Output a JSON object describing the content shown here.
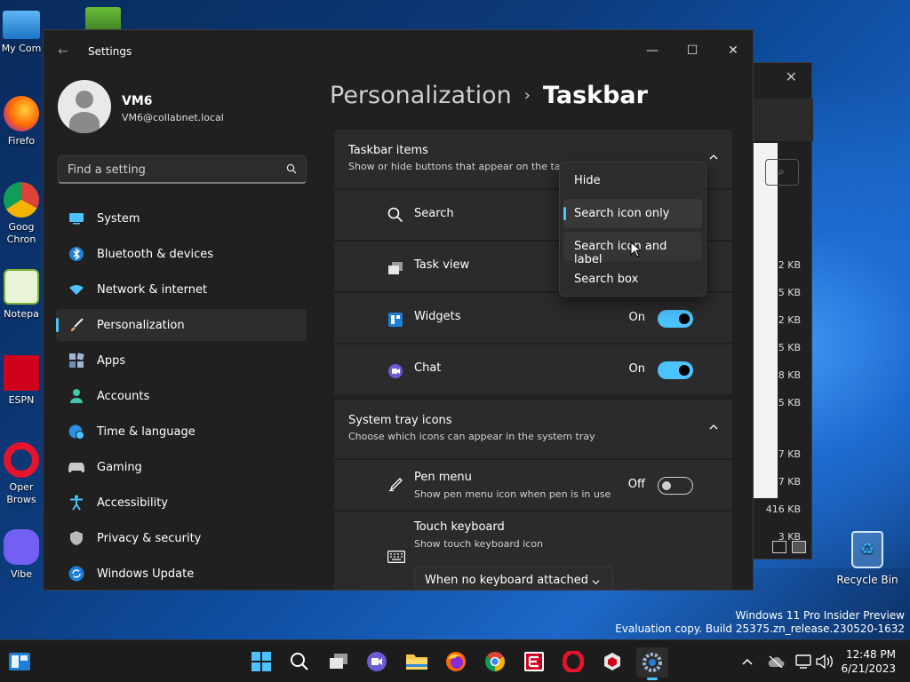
{
  "desktop": {
    "icons": [
      {
        "label": "My Com",
        "icon": "computer-icon"
      },
      {
        "label": "Firefo",
        "icon": "firefox-icon"
      },
      {
        "label": "Goog Chron",
        "icon": "chrome-icon"
      },
      {
        "label": "Notepa",
        "icon": "notepad-icon"
      },
      {
        "label": "ESPN",
        "icon": "espn-icon"
      },
      {
        "label": "Oper Brows",
        "icon": "opera-icon"
      },
      {
        "label": "Vibe",
        "icon": "viber-icon"
      }
    ],
    "recycle_bin": "Recycle Bin"
  },
  "explorer_window": {
    "sizes": [
      "2 KB",
      "5 KB",
      "2 KB",
      "5 KB",
      "8 KB",
      "5 KB",
      "",
      "7 KB",
      "7 KB",
      "416 KB",
      "3 KB"
    ]
  },
  "settings": {
    "app_title": "Settings",
    "window_controls": {
      "minimize": "—",
      "maximize": "☐",
      "close": "✕"
    },
    "profile": {
      "name": "VM6",
      "email": "VM6@collabnet.local"
    },
    "search": {
      "placeholder": "Find a setting"
    },
    "nav": [
      {
        "label": "System",
        "icon": "system-icon",
        "color": "#4cc2ff"
      },
      {
        "label": "Bluetooth & devices",
        "icon": "bluetooth-icon",
        "color": "#4cc2ff"
      },
      {
        "label": "Network & internet",
        "icon": "wifi-icon",
        "color": "#4cc2ff"
      },
      {
        "label": "Personalization",
        "icon": "brush-icon",
        "color": "#e8a15a",
        "active": true
      },
      {
        "label": "Apps",
        "icon": "apps-icon",
        "color": "#9fb7d4"
      },
      {
        "label": "Accounts",
        "icon": "person-icon",
        "color": "#3fc7a9"
      },
      {
        "label": "Time & language",
        "icon": "globe-clock-icon",
        "color": "#4cc2ff"
      },
      {
        "label": "Gaming",
        "icon": "gamepad-icon",
        "color": "#c9c9c9"
      },
      {
        "label": "Accessibility",
        "icon": "accessibility-icon",
        "color": "#4cc2ff"
      },
      {
        "label": "Privacy & security",
        "icon": "shield-icon",
        "color": "#b9b9b9"
      },
      {
        "label": "Windows Update",
        "icon": "update-icon",
        "color": "#4cc2ff"
      }
    ],
    "breadcrumb": {
      "parent": "Personalization",
      "separator": "›",
      "current": "Taskbar"
    },
    "taskbar_items": {
      "title": "Taskbar items",
      "subtitle": "Show or hide buttons that appear on the tas",
      "rows": [
        {
          "label": "Search",
          "icon": "search-icon"
        },
        {
          "label": "Task view",
          "icon": "task-view-icon"
        },
        {
          "label": "Widgets",
          "icon": "widgets-icon",
          "state": "On",
          "on": true
        },
        {
          "label": "Chat",
          "icon": "chat-icon",
          "state": "On",
          "on": true
        }
      ]
    },
    "system_tray": {
      "title": "System tray icons",
      "subtitle": "Choose which icons can appear in the system tray",
      "pen": {
        "label": "Pen menu",
        "sub": "Show pen menu icon when pen is in use",
        "state": "Off"
      },
      "touch": {
        "label": "Touch keyboard",
        "sub": "Show touch keyboard icon",
        "select": "When no keyboard attached"
      }
    },
    "search_dropdown": {
      "options": [
        "Hide",
        "Search icon only",
        "Search icon and label",
        "Search box"
      ],
      "selected": "Search icon only"
    }
  },
  "watermark": {
    "line1": "Windows 11 Pro Insider Preview",
    "line2": "Evaluation copy. Build 25375.zn_release.230520-1632"
  },
  "taskbar": {
    "apps": [
      "start-icon",
      "search-icon",
      "task-view-icon",
      "chat-icon",
      "file-explorer-icon",
      "firefox-icon",
      "chrome-icon",
      "espn-icon",
      "opera-icon",
      "app-icon",
      "settings-icon"
    ],
    "clock": {
      "time": "12:48 PM",
      "date": "6/21/2023"
    }
  },
  "colors": {
    "accent": "#4cc2ff",
    "window_bg": "#202020",
    "card_bg": "#2b2b2b"
  }
}
